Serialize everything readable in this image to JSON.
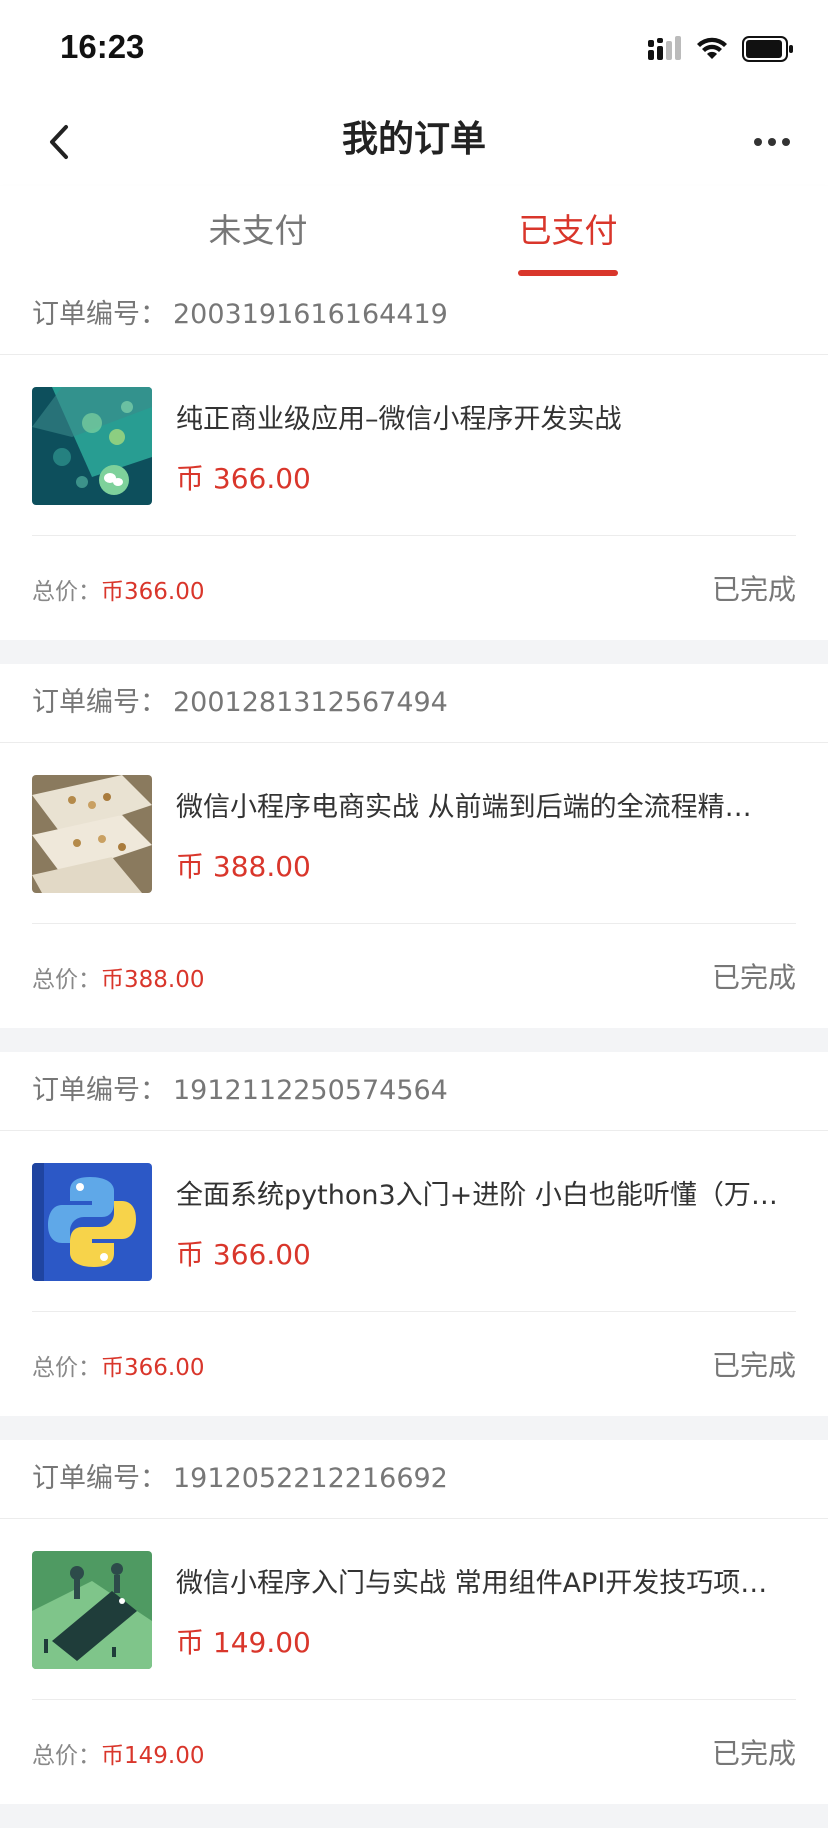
{
  "status_bar": {
    "time": "16:23"
  },
  "header": {
    "title": "我的订单"
  },
  "tabs": [
    {
      "label": "未支付",
      "active": false
    },
    {
      "label": "已支付",
      "active": true
    }
  ],
  "colors": {
    "accent": "#d9362b",
    "background": "#f3f4f6"
  },
  "orders": [
    {
      "order_label": "订单编号：",
      "order_no": "2003191616164419",
      "title": "纯正商业级应用–微信小程序开发实战",
      "price": "币 366.00",
      "total_label": "总价：",
      "total": "币366.00",
      "status": "已完成",
      "thumb_icon": "wechat-course-thumbnail-icon"
    },
    {
      "order_label": "订单编号：",
      "order_no": "2001281312567494",
      "title": "微信小程序电商实战 从前端到后端的全流程精…",
      "price": "币 388.00",
      "total_label": "总价：",
      "total": "币388.00",
      "status": "已完成",
      "thumb_icon": "ecommerce-course-thumbnail-icon"
    },
    {
      "order_label": "订单编号：",
      "order_no": "1912112250574564",
      "title": "全面系统python3入门+进阶 小白也能听懂（万…",
      "price": "币 366.00",
      "total_label": "总价：",
      "total": "币366.00",
      "status": "已完成",
      "thumb_icon": "python-logo-thumbnail-icon"
    },
    {
      "order_label": "订单编号：",
      "order_no": "1912052212216692",
      "title": "微信小程序入门与实战 常用组件API开发技巧项…",
      "price": "币 149.00",
      "total_label": "总价：",
      "total": "币149.00",
      "status": "已完成",
      "thumb_icon": "miniprogram-course-thumbnail-icon"
    }
  ]
}
